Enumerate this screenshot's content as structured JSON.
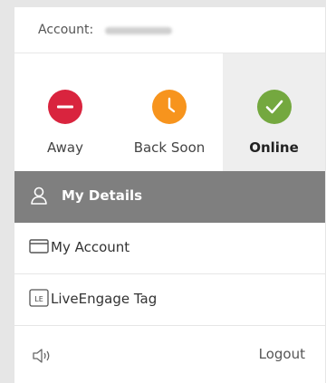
{
  "account": {
    "label": "Account:",
    "id_masked": "blurred-account-id"
  },
  "statuses": [
    {
      "key": "away",
      "label": "Away",
      "color": "#d9243e",
      "icon": "minus-icon"
    },
    {
      "key": "back_soon",
      "label": "Back Soon",
      "color": "#f7941d",
      "icon": "clock-icon"
    },
    {
      "key": "online",
      "label": "Online",
      "color": "#74a83f",
      "icon": "checkmark-icon",
      "selected": true
    }
  ],
  "menu": {
    "items": [
      {
        "label": "My Details",
        "icon": "user-icon",
        "active": true
      },
      {
        "label": "My Account",
        "icon": "card-icon",
        "active": false
      },
      {
        "label": "LiveEngage Tag",
        "icon": "le-tag-icon",
        "icon_text": "LE",
        "active": false
      }
    ]
  },
  "footer": {
    "sound_icon": "speaker-icon",
    "logout_label": "Logout"
  },
  "colors": {
    "active_bg": "#7f7f7f",
    "selected_status_bg": "#eeeeee",
    "page_bg": "#e6e6e6"
  }
}
